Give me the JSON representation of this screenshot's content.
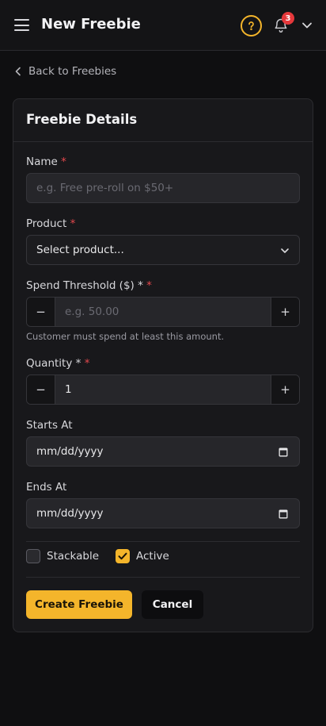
{
  "header": {
    "title": "New Freebie",
    "notification_count": "3",
    "accent_color": "#f4b52b",
    "icons": [
      "menu-icon",
      "help-icon",
      "bell-icon",
      "chevron-down-icon"
    ]
  },
  "nav": {
    "back_label": "Back to Freebies"
  },
  "form": {
    "title": "Freebie Details",
    "required_mark": "*",
    "name": {
      "label": "Name",
      "placeholder": "e.g. Free pre-roll on $50+"
    },
    "product": {
      "label": "Product",
      "selected": "Select product..."
    },
    "threshold": {
      "label": "Spend Threshold ($) *",
      "placeholder": "e.g. 50.00",
      "help": "Customer must spend at least this amount.",
      "minus": "−",
      "plus": "+"
    },
    "quantity": {
      "label": "Quantity *",
      "value": "1",
      "minus": "−",
      "plus": "+"
    },
    "starts_at": {
      "label": "Starts At",
      "value": "mm/dd/yyyy"
    },
    "ends_at": {
      "label": "Ends At",
      "value": "mm/dd/yyyy"
    },
    "stackable": {
      "label": "Stackable",
      "checked": false
    },
    "active": {
      "label": "Active",
      "checked": true
    },
    "submit_label": "Create Freebie",
    "cancel_label": "Cancel"
  }
}
